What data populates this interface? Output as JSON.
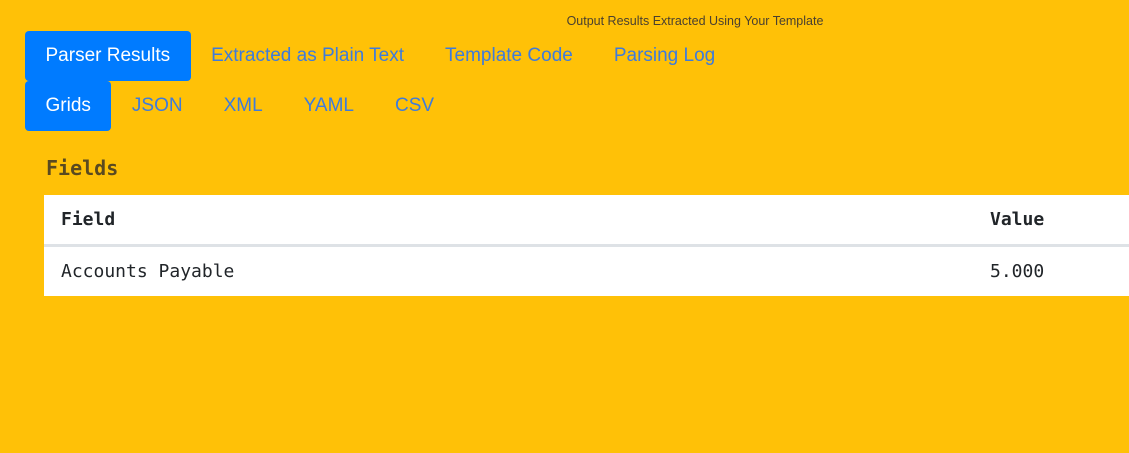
{
  "header": {
    "caption": "Output Results Extracted Using Your Template"
  },
  "primary_tabs": [
    {
      "label": "Parser Results",
      "active": true
    },
    {
      "label": "Extracted as Plain Text",
      "active": false
    },
    {
      "label": "Template Code",
      "active": false
    },
    {
      "label": "Parsing Log",
      "active": false
    }
  ],
  "secondary_tabs": [
    {
      "label": "Grids",
      "active": true
    },
    {
      "label": "JSON",
      "active": false
    },
    {
      "label": "XML",
      "active": false
    },
    {
      "label": "YAML",
      "active": false
    },
    {
      "label": "CSV",
      "active": false
    }
  ],
  "fields_section": {
    "title": "Fields",
    "columns": [
      "Field",
      "Value"
    ],
    "rows": [
      {
        "field": "Accounts Payable",
        "value": "5.000"
      }
    ]
  },
  "colors": {
    "background": "#FFC107",
    "active_tab": "#007BFF",
    "tab_link": "#3e7bdc"
  }
}
